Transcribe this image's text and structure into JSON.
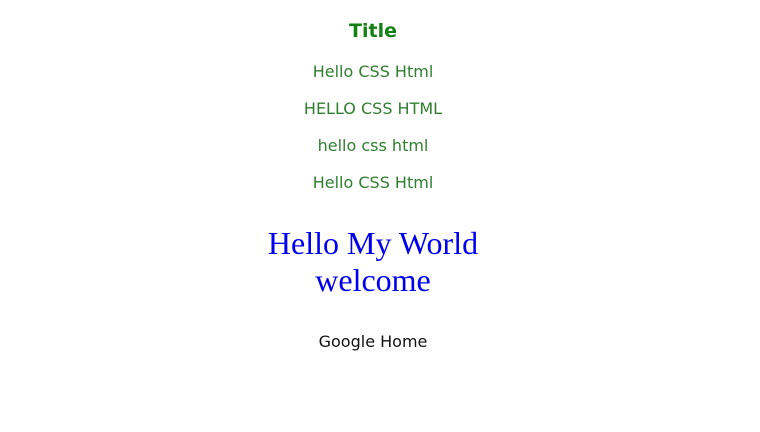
{
  "title": "Title",
  "lines": [
    "Hello CSS Html",
    "HELLO CSS HTML",
    "hello css html",
    "Hello CSS Html"
  ],
  "heading": {
    "line1": "Hello My World",
    "line2": "welcome"
  },
  "link": {
    "label": "Google Home"
  },
  "colors": {
    "title": "#138013",
    "lines": "#2f7f2f",
    "heading": "#0000ee",
    "link": "#111111",
    "background": "#ffffff"
  }
}
